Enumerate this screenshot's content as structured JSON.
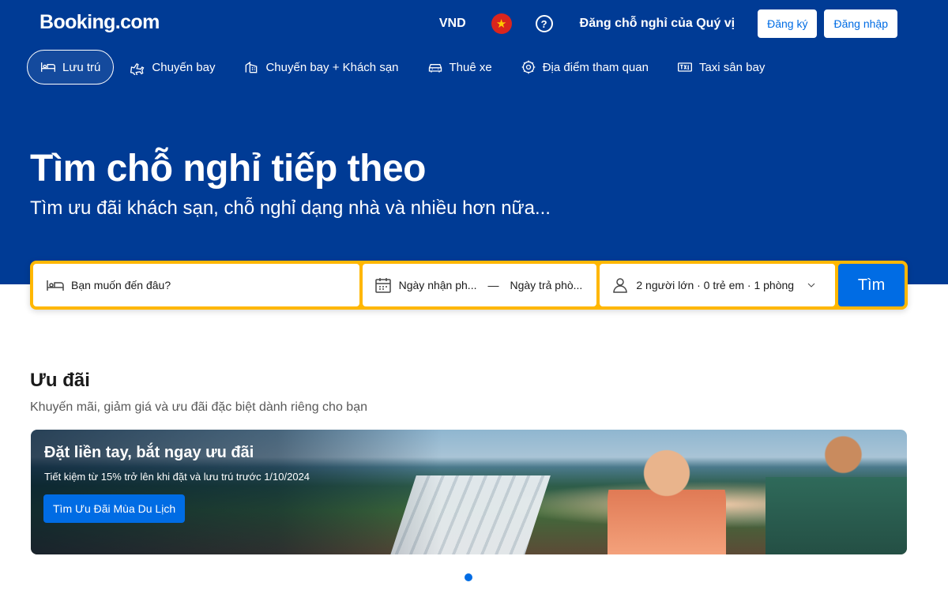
{
  "header": {
    "logo": "Booking.com",
    "currency": "VND",
    "flag_icon": "vietnam-flag-icon",
    "help_icon": "question-icon",
    "list_property": "Đăng chỗ nghỉ của Quý vị",
    "register_label": "Đăng ký",
    "login_label": "Đăng nhập"
  },
  "nav": {
    "items": [
      {
        "label": "Lưu trú",
        "icon": "bed-icon",
        "active": true
      },
      {
        "label": "Chuyến bay",
        "icon": "plane-icon",
        "active": false
      },
      {
        "label": "Chuyến bay + Khách sạn",
        "icon": "plane-hotel-icon",
        "active": false
      },
      {
        "label": "Thuê xe",
        "icon": "car-icon",
        "active": false
      },
      {
        "label": "Địa điểm tham quan",
        "icon": "attractions-icon",
        "active": false
      },
      {
        "label": "Taxi sân bay",
        "icon": "taxi-icon",
        "active": false
      }
    ]
  },
  "hero": {
    "title": "Tìm chỗ nghỉ tiếp theo",
    "subtitle": "Tìm ưu đãi khách sạn, chỗ nghỉ dạng nhà và nhiều hơn nữa..."
  },
  "search": {
    "destination_placeholder": "Bạn muốn đến đâu?",
    "checkin_placeholder": "Ngày nhận ph...",
    "date_separator": "—",
    "checkout_placeholder": "Ngày trả phò...",
    "guests_value": "2 người lớn · 0 trẻ em · 1 phòng",
    "submit_label": "Tìm"
  },
  "offers": {
    "title": "Ưu đãi",
    "subtitle": "Khuyến mãi, giảm giá và ưu đãi đặc biệt dành riêng cho bạn",
    "banner": {
      "title": "Đặt liền tay, bắt ngay ưu đãi",
      "text": "Tiết kiệm từ 15% trở lên khi đặt và lưu trú trước 1/10/2024",
      "button_label": "Tìm Ưu Đãi Mùa Du Lịch"
    }
  },
  "colors": {
    "brand_blue": "#003b95",
    "action_blue": "#006ce4",
    "search_border": "#ffb700"
  }
}
